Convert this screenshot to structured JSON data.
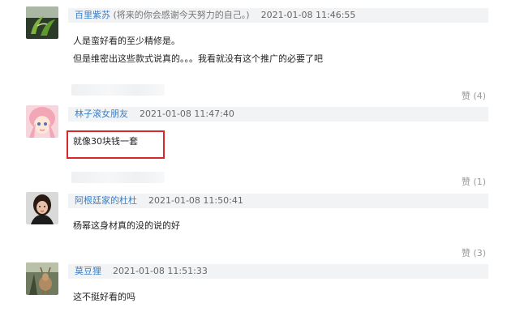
{
  "comments": [
    {
      "username": "百里紫苏",
      "signature": " (将来的你会感谢今天努力的自己。)",
      "time": "2021-01-08 11:46:55",
      "lines": [
        "人是蛮好看的至少精修是。",
        "但是维密出这些款式说真的。。。我看就没有这个推广的必要了吧"
      ],
      "like": "赞 (4)",
      "avatar": "plant-avatar"
    },
    {
      "username": "林子滚女朋友",
      "signature": "",
      "time": "2021-01-08 11:47:40",
      "lines": [
        "就像30块钱一套"
      ],
      "like": "赞 (1)",
      "avatar": "anime-girl-avatar"
    },
    {
      "username": "阿根廷家的杜杜",
      "signature": "",
      "time": "2021-01-08 11:50:41",
      "lines": [
        "杨幂这身材真的没的说的好"
      ],
      "like": "赞 (3)",
      "avatar": "woman-photo-avatar"
    },
    {
      "username": "莫豆狸",
      "signature": "",
      "time": "2021-01-08 11:51:33",
      "lines": [
        "这不挺好看的吗"
      ],
      "like": "",
      "avatar": "deer-avatar"
    }
  ],
  "colors": {
    "username": "#3b7fc4",
    "highlight_border": "#d9272e",
    "header_bg": "#f2f3f5"
  }
}
